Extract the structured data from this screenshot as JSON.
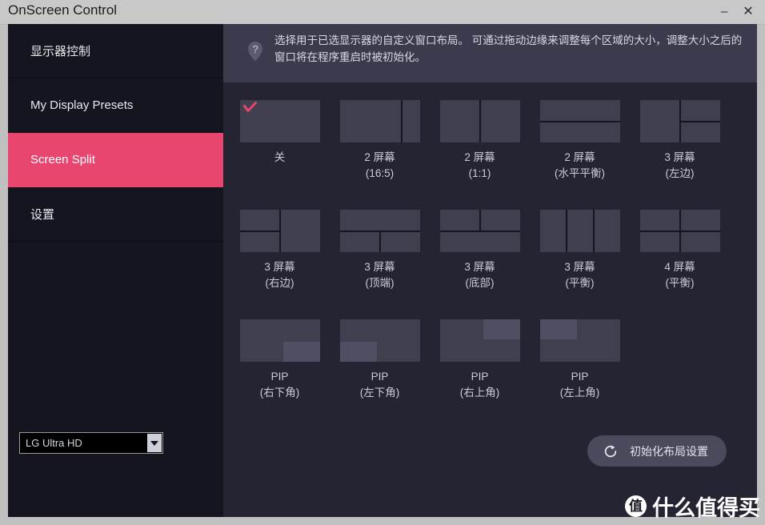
{
  "window": {
    "title": "OnScreen Control",
    "minimize_label": "–",
    "close_label": "✕"
  },
  "sidebar": {
    "items": [
      {
        "label": "显示器控制",
        "active": false
      },
      {
        "label": "My Display Presets",
        "active": false
      },
      {
        "label": "Screen Split",
        "active": true
      },
      {
        "label": "设置",
        "active": false
      }
    ],
    "monitor_select": {
      "value": "LG Ultra HD",
      "icon": "chevron-down-icon"
    }
  },
  "banner": {
    "icon": "help-pin-icon",
    "text": "选择用于已选显示器的自定义窗口布局。\n可通过拖动边缘来调整每个区域的大小，调整大小之后的窗口将在程序重启时被初始化。"
  },
  "layouts": [
    {
      "label": "关",
      "type": "single",
      "selected": true
    },
    {
      "label": "2 屏幕\n(16:5)",
      "type": "v2-165",
      "selected": false
    },
    {
      "label": "2 屏幕\n(1:1)",
      "type": "v2-11",
      "selected": false
    },
    {
      "label": "2 屏幕\n(水平平衡)",
      "type": "h2",
      "selected": false
    },
    {
      "label": "3 屏幕\n(左边)",
      "type": "left-big",
      "selected": false
    },
    {
      "label": "3 屏幕\n(右边)",
      "type": "right-big",
      "selected": false
    },
    {
      "label": "3 屏幕\n(顶端)",
      "type": "top-big",
      "selected": false
    },
    {
      "label": "3 屏幕\n(底部)",
      "type": "bottom-big",
      "selected": false
    },
    {
      "label": "3 屏幕\n(平衡)",
      "type": "v3",
      "selected": false
    },
    {
      "label": "4 屏幕\n(平衡)",
      "type": "quad",
      "selected": false
    },
    {
      "label": "PIP\n(右下角)",
      "type": "pip-br",
      "selected": false
    },
    {
      "label": "PIP\n(左下角)",
      "type": "pip-bl",
      "selected": false
    },
    {
      "label": "PIP\n(右上角)",
      "type": "pip-tr",
      "selected": false
    },
    {
      "label": "PIP\n(左上角)",
      "type": "pip-tl",
      "selected": false
    }
  ],
  "reset_button": {
    "label": "初始化布局设置",
    "icon": "refresh-icon"
  },
  "watermark": {
    "logo_text": "值",
    "text": "什么值得买"
  },
  "colors": {
    "accent": "#e8456f",
    "sidebar_bg": "#15151f",
    "main_bg": "#242433",
    "banner_bg": "#3b3b4d",
    "tile_bg": "#3f3f4f",
    "pip_inset": "#4f4f63",
    "titlebar_bg": "#c8c8c8"
  }
}
